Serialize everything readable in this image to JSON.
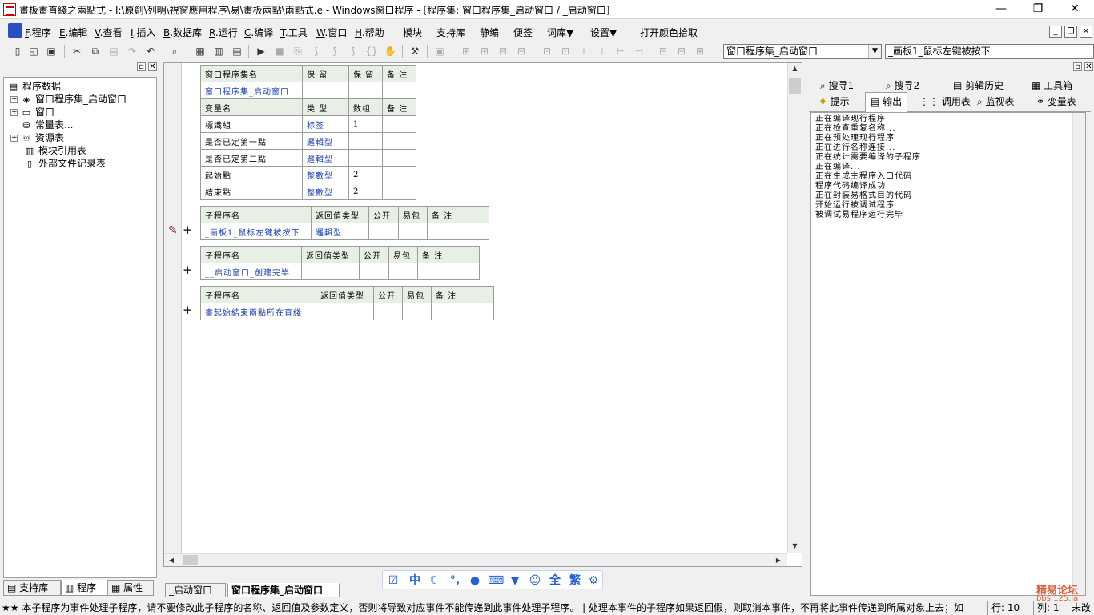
{
  "window": {
    "title": "畫板畫直綫之兩點式 - I:\\原創\\列明\\視窗應用程序\\易\\畫板兩點\\兩點式.e - Windows窗口程序 - [程序集: 窗口程序集_启动窗口 / _启动窗口]",
    "controls": [
      "—",
      "❐",
      "✕"
    ]
  },
  "menu": {
    "items": [
      {
        "key": "F",
        "label": ".程序"
      },
      {
        "key": "E",
        "label": ".编辑"
      },
      {
        "key": "V",
        "label": ".查看"
      },
      {
        "key": "I",
        "label": ".插入"
      },
      {
        "key": "B",
        "label": ".数据库"
      },
      {
        "key": "R",
        "label": ".运行"
      },
      {
        "key": "C",
        "label": ".编译"
      },
      {
        "key": "T",
        "label": ".工具"
      },
      {
        "key": "W",
        "label": ".窗口"
      },
      {
        "key": "H",
        "label": ".帮助"
      }
    ],
    "extra": [
      "模块",
      "支持库",
      "静编",
      "便签",
      "词库▼",
      "设置▼",
      "打开颜色拾取"
    ]
  },
  "toolbar": {
    "assembly_combo": "窗口程序集_启动窗口",
    "sub_combo": "_画板1_鼠标左键被按下"
  },
  "left_panel": {
    "root": "程序数据",
    "nodes": [
      {
        "label": "窗口程序集_启动窗口",
        "icon": "assembly-icon",
        "expandable": true
      },
      {
        "label": "窗口",
        "icon": "window-icon",
        "expandable": true
      },
      {
        "label": "常量表...",
        "icon": "constant-icon",
        "expandable": false
      },
      {
        "label": "资源表",
        "icon": "resource-icon",
        "expandable": true
      },
      {
        "label": "模块引用表",
        "icon": "module-icon",
        "expandable": false
      },
      {
        "label": "外部文件记录表",
        "icon": "file-icon",
        "expandable": false
      }
    ],
    "tabs": [
      "支持库",
      "程序",
      "属性"
    ]
  },
  "editor": {
    "assembly_table": {
      "headers": [
        "窗口程序集名",
        "保 留",
        "保 留",
        "备 注"
      ],
      "row": [
        "窗口程序集_启动窗口",
        "",
        "",
        ""
      ],
      "var_headers": [
        "变量名",
        "类 型",
        "数组",
        "备 注"
      ],
      "vars": [
        [
          "標識組",
          "标签",
          "1",
          ""
        ],
        [
          "是否已定第一點",
          "邏輯型",
          "",
          ""
        ],
        [
          "是否已定第二點",
          "邏輯型",
          "",
          ""
        ],
        [
          "起始點",
          "整數型",
          "2",
          ""
        ],
        [
          "結束點",
          "整數型",
          "2",
          ""
        ]
      ]
    },
    "subs": [
      {
        "headers": [
          "子程序名",
          "返回值类型",
          "公开",
          "易包",
          "备 注"
        ],
        "row": [
          "_画板1_鼠标左键被按下",
          "邏輯型",
          "",
          "",
          ""
        ]
      },
      {
        "headers": [
          "子程序名",
          "返回值类型",
          "公开",
          "易包",
          "备 注"
        ],
        "row": [
          "__启动窗口_创建完毕",
          "",
          "",
          "",
          ""
        ]
      },
      {
        "headers": [
          "子程序名",
          "返回值类型",
          "公开",
          "易包",
          "备 注"
        ],
        "row": [
          "畫起始結束兩點所在直綫",
          "",
          "",
          "",
          ""
        ]
      }
    ],
    "tabs": [
      "_启动窗口",
      "窗口程序集_启动窗口"
    ]
  },
  "right_panel": {
    "tabs_row1": [
      "搜寻1",
      "搜寻2",
      "剪辑历史",
      "工具箱"
    ],
    "tabs_row2": [
      "提示",
      "输出",
      "调用表",
      "监视表",
      "变量表"
    ],
    "output_lines": [
      "正在编译现行程序",
      "正在检查重复名称...",
      "正在预处理现行程序",
      "正在进行名称连接...",
      "正在统计需要编译的子程序",
      "正在编译...",
      "正在生成主程序入口代码",
      "程序代码编译成功",
      "正在封装易格式目的代码",
      "开始运行被调试程序",
      "被调试易程序运行完毕"
    ]
  },
  "ime": [
    "中",
    "全",
    "繁"
  ],
  "status": {
    "message": "★★ 本子程序为事件处理子程序，请不要修改此子程序的名称、返回值及参数定义，否则将导致对应事件不能传递到此事件处理子程序。 | 处理本事件的子程序如果返回假，则取消本事件，不再将此事件传递到所属对象上去；如",
    "line": "行: 10",
    "col": "列: 1",
    "mode": "未改"
  },
  "watermark": {
    "line1": "精易论坛",
    "line2": "bbs.125.la"
  }
}
